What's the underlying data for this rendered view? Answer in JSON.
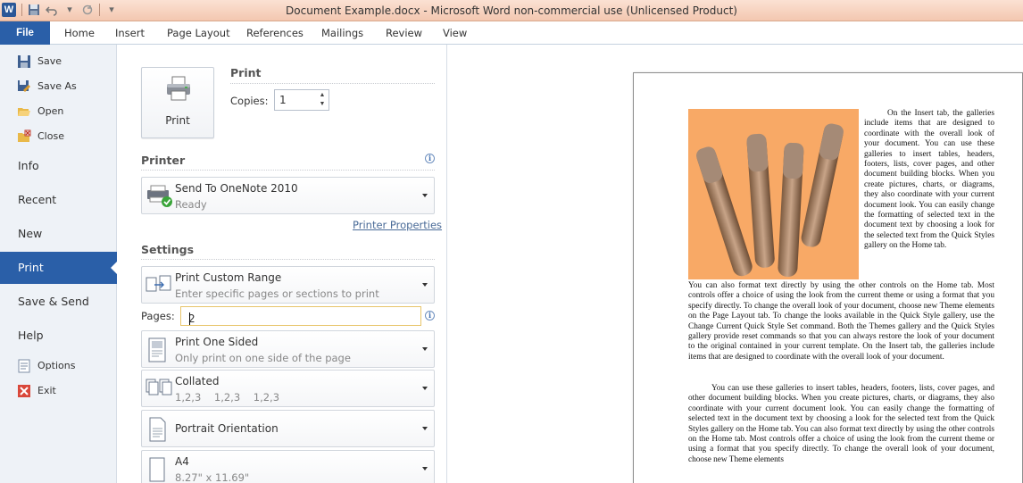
{
  "window": {
    "title": "Document Example.docx  -  Microsoft Word non-commercial use (Unlicensed Product)",
    "logo_letter": "W"
  },
  "ribbon": {
    "tabs": [
      "File",
      "Home",
      "Insert",
      "Page Layout",
      "References",
      "Mailings",
      "Review",
      "View"
    ]
  },
  "backstage": {
    "items": {
      "save": "Save",
      "save_as": "Save As",
      "open": "Open",
      "close": "Close",
      "info": "Info",
      "recent": "Recent",
      "new": "New",
      "print": "Print",
      "save_send": "Save & Send",
      "help": "Help",
      "options": "Options",
      "exit": "Exit"
    },
    "active": "Print"
  },
  "print_panel": {
    "print_button": "Print",
    "section_print": "Print",
    "copies_label": "Copies:",
    "copies_value": "1",
    "section_printer": "Printer",
    "printer_name": "Send To OneNote 2010",
    "printer_status": "Ready",
    "printer_properties": "Printer Properties",
    "section_settings": "Settings",
    "range_title": "Print Custom Range",
    "range_desc": "Enter specific pages or sections to print",
    "pages_label": "Pages:",
    "pages_value": "2",
    "sided_title": "Print One Sided",
    "sided_desc": "Only print on one side of the page",
    "collated_title": "Collated",
    "collated_desc": "1,2,3    1,2,3    1,2,3",
    "orientation_title": "Portrait Orientation",
    "paper_title": "A4",
    "paper_desc": "8.27\" x 11.69\""
  },
  "preview": {
    "para1": "On the Insert tab, the galleries include items that are designed to coordinate with the overall look of your document. You can use these galleries to insert tables, headers, footers, lists, cover pages, and other document building blocks. When you create pictures, charts, or diagrams, they also coordinate with your current document look. You can easily change the formatting of selected text in the document text by choosing a look for the selected text from the Quick Styles gallery on the Home tab.",
    "para2": "You can also format text directly by using the other controls on the Home tab. Most controls offer a choice of using the look from the current theme or using a format that you specify directly. To change the overall look of your document, choose new Theme elements on the Page Layout tab. To change the looks available in the Quick Style gallery, use the Change Current Quick Style Set command. Both the Themes gallery and the Quick Styles gallery provide reset commands so that you can always restore the look of your document to the original contained in your current template. On the Insert tab, the galleries include items that are designed to coordinate with the overall look of your document.",
    "para3": "You can use these galleries to insert tables, headers, footers, lists, cover pages, and other document building blocks. When you create pictures, charts, or diagrams, they also coordinate with your current document look. You can easily change the formatting of selected text in the document text by choosing a look for the selected text from the Quick Styles gallery on the Home tab. You can also format text directly by using the other controls on the Home tab. Most controls offer a choice of using the look from the current theme or using a format that you specify directly. To change the overall look of your document, choose new Theme elements"
  },
  "colors": {
    "accent": "#2a5fa8",
    "titlebar": "#f3c7b0",
    "photo_bg": "#f8a966"
  }
}
